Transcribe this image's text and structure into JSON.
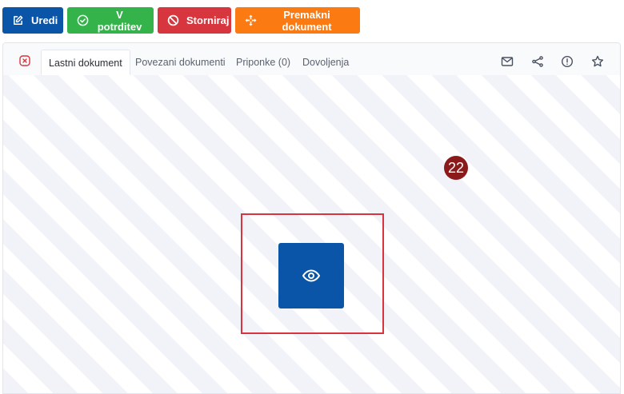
{
  "toolbar": {
    "edit_label": "Uredi",
    "confirm_label": "V potrditev",
    "cancel_label": "Storniraj",
    "move_label": "Premakni dokument"
  },
  "tabs": [
    {
      "label": "Lastni dokument",
      "active": true
    },
    {
      "label": "Povezani dokumenti",
      "active": false
    },
    {
      "label": "Priponke (0)",
      "active": false
    },
    {
      "label": "Dovoljenja",
      "active": false
    }
  ],
  "tab_actions": [
    "mail-icon",
    "share-icon",
    "info-icon",
    "star-icon"
  ],
  "badge": {
    "value": "22"
  },
  "colors": {
    "primary": "#0b55a8",
    "success": "#33b34a",
    "danger": "#d8363e",
    "warning": "#fb7a12",
    "badge": "#8b1a1a"
  }
}
